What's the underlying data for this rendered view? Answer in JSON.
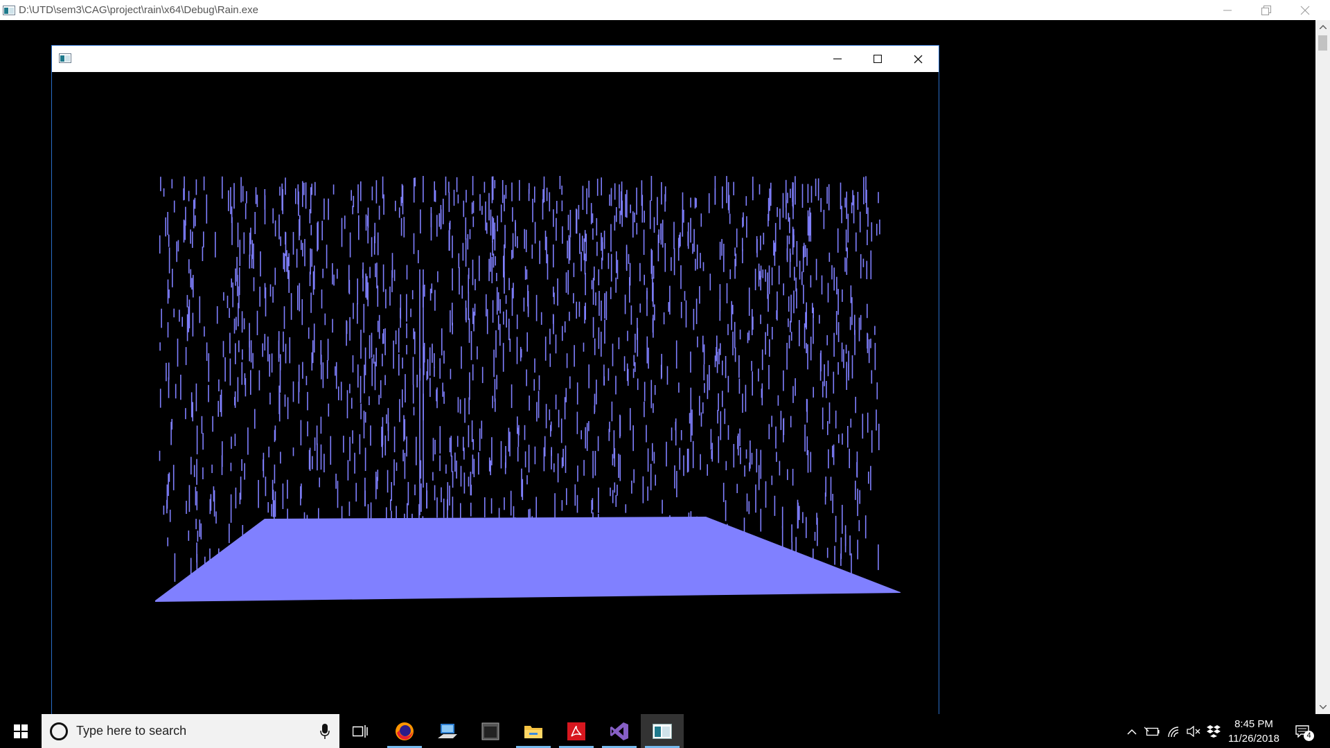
{
  "console_window": {
    "title": "D:\\UTD\\sem3\\CAG\\project\\rain\\x64\\Debug\\Rain.exe"
  },
  "gl_window": {
    "title": ""
  },
  "scene": {
    "background_color": "#000000",
    "rain_color": "#8080ff",
    "ground_color": "#8080ff"
  },
  "taskbar": {
    "search_placeholder": "Type here to search",
    "pinned_icons": [
      "task-view-icon",
      "firefox-icon",
      "remote-desktop-icon",
      "app-window-icon",
      "file-explorer-icon",
      "acrobat-icon",
      "visual-studio-icon",
      "rain-app-icon"
    ],
    "active_underline_color": "#76b9ed"
  },
  "tray": {
    "time": "8:45 PM",
    "date": "11/26/2018",
    "notification_count": "4"
  }
}
